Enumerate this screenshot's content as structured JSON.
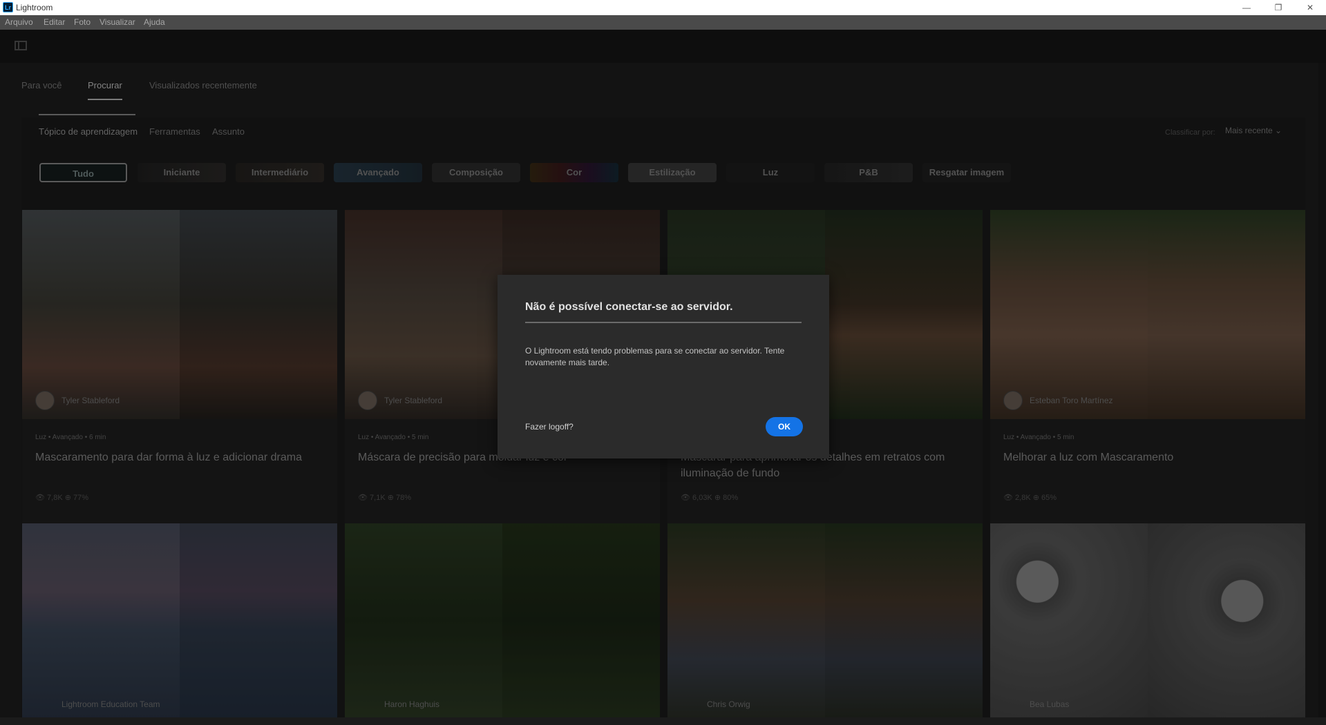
{
  "window": {
    "app_icon_text": "Lr",
    "title": "Lightroom",
    "minimize_glyph": "—",
    "maximize_glyph": "❐",
    "close_glyph": "✕"
  },
  "menu": [
    "Arquivo",
    "Editar",
    "Foto",
    "Visualizar",
    "Ajuda"
  ],
  "main_tabs": [
    "Para você",
    "Procurar",
    "Visualizados recentemente"
  ],
  "active_main_tab": "Procurar",
  "sub_tabs": [
    "Tópico de aprendizagem",
    "Ferramentas",
    "Assunto"
  ],
  "active_sub_tab": "Tópico de aprendizagem",
  "sort": {
    "label": "Classificar por:",
    "value": "Mais recente ⌄"
  },
  "filter_chips": [
    "Tudo",
    "Iniciante",
    "Intermediário",
    "Avançado",
    "Composição",
    "Cor",
    "Estilização",
    "Luz",
    "P&B",
    "Resgatar imagem"
  ],
  "active_chip": "Tudo",
  "cards_row1": [
    {
      "author": "Tyler Stableford",
      "meta": "Luz • Avançado • 6 min",
      "title": "Mascaramento para dar forma à luz e adicionar drama",
      "stats": "👁 7,8K   ⊕ 77%"
    },
    {
      "author": "Tyler Stableford",
      "meta": "Luz • Avançado • 5 min",
      "title": "Máscara de precisão para moldar luz e cor",
      "stats": "👁 7,1K   ⊕ 78%"
    },
    {
      "author": "",
      "meta": "",
      "title": "Mascarar para aprimorar os detalhes em retratos com iluminação de fundo",
      "stats": "👁 6,03K   ⊕ 80%"
    },
    {
      "author": "Esteban Toro Martínez",
      "meta": "Luz • Avançado • 5 min",
      "title": "Melhorar a luz com Mascaramento",
      "stats": "👁 2,8K   ⊕ 65%"
    }
  ],
  "cards_row2": [
    {
      "author": "Lightroom Education Team"
    },
    {
      "author": "Haron Haghuis"
    },
    {
      "author": "Chris Orwig"
    },
    {
      "author": "Bea Lubas"
    }
  ],
  "dialog": {
    "title": "Não é possível conectar-se ao servidor.",
    "body": "O Lightroom está tendo problemas para se conectar ao servidor. Tente novamente mais tarde.",
    "logoff_link": "Fazer logoff?",
    "ok_label": "OK"
  }
}
